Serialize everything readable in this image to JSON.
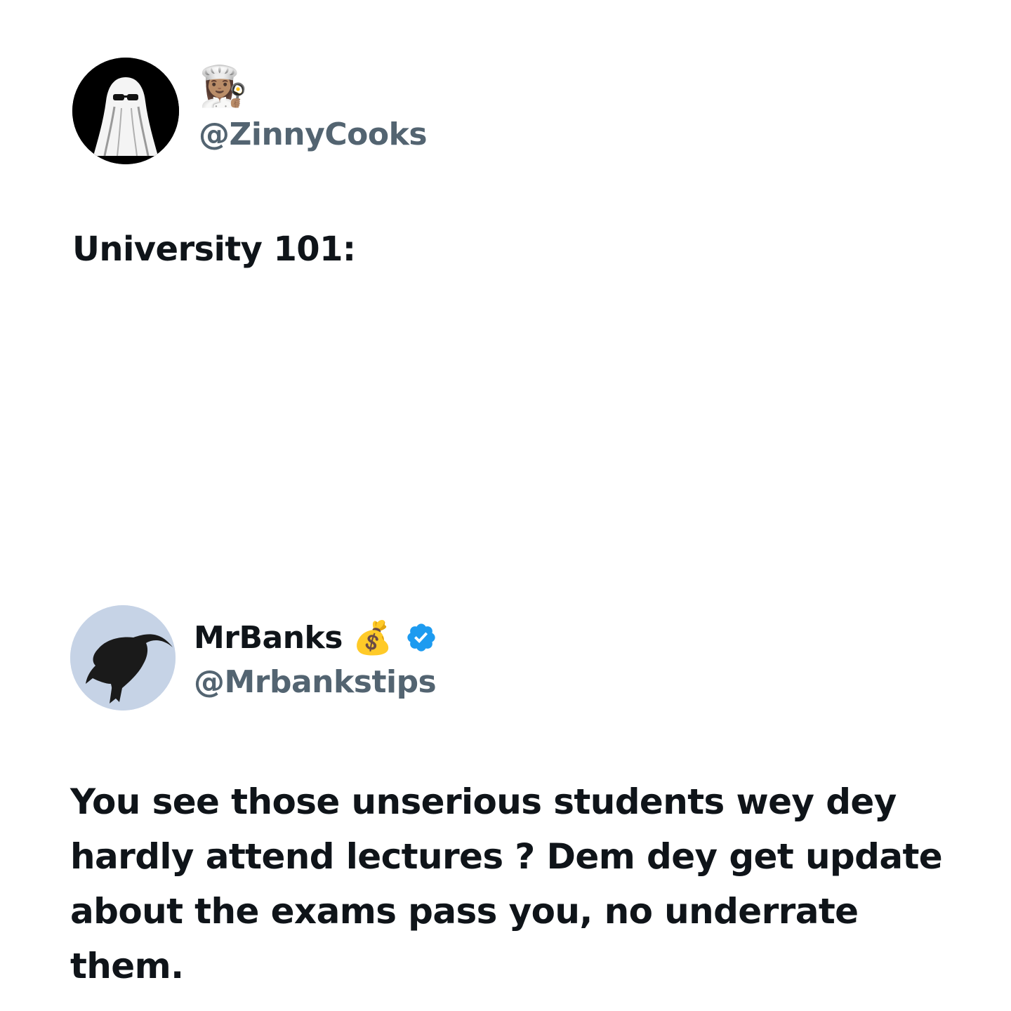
{
  "posts": [
    {
      "handle": "@ZinnyCooks",
      "name_emoji": "👩🏽‍🍳",
      "avatar_icon": "ghost-sunglasses-avatar",
      "text": "University 101:"
    },
    {
      "display_name": "MrBanks",
      "name_emoji": "💰",
      "verified": true,
      "verified_color": "#1d9bf0",
      "handle": "@Mrbankstips",
      "avatar_icon": "goat-silhouette-avatar",
      "text": "You see those unserious students wey dey hardly attend lectures ? Dem dey get update about the exams pass you, no underrate them."
    }
  ]
}
